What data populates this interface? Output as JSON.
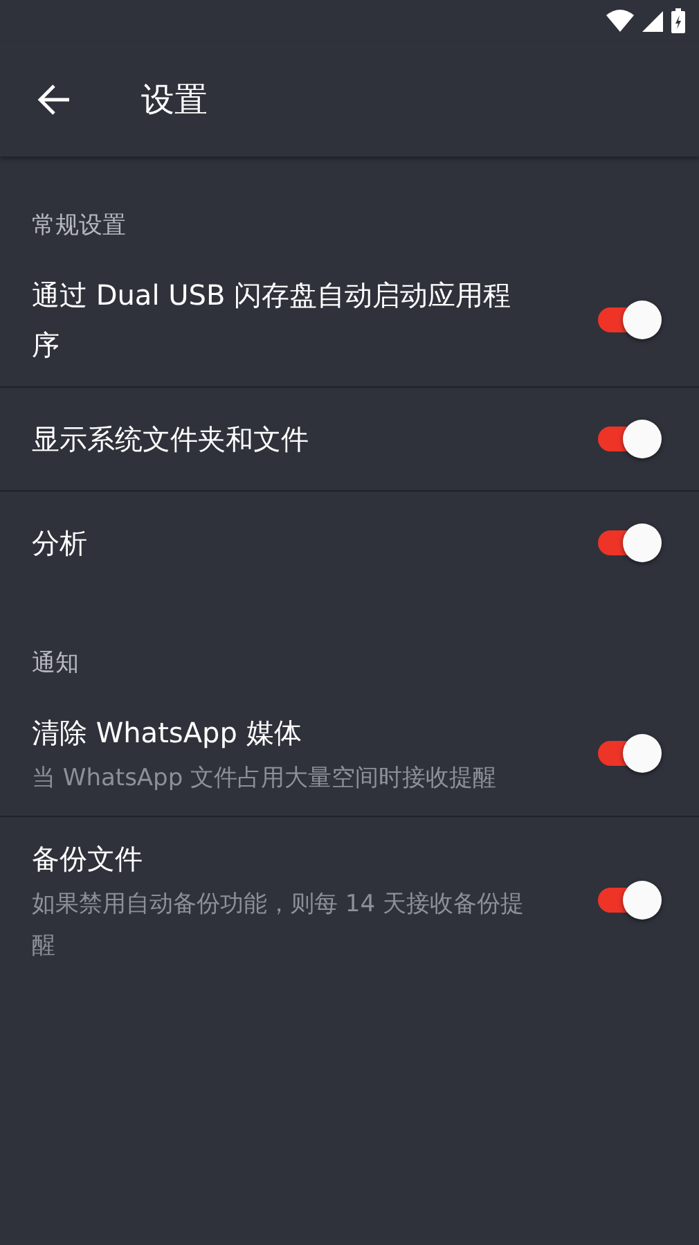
{
  "app_bar": {
    "title": "设置"
  },
  "sections": [
    {
      "header": "常规设置",
      "items": [
        {
          "title": "通过 Dual USB 闪存盘自动启动应用程序",
          "on": true
        },
        {
          "title": "显示系统文件夹和文件",
          "on": true
        },
        {
          "title": "分析",
          "on": true
        }
      ]
    },
    {
      "header": "通知",
      "items": [
        {
          "title": "清除 WhatsApp 媒体",
          "subtitle": "当 WhatsApp 文件占用大量空间时接收提醒",
          "on": true
        },
        {
          "title": "备份文件",
          "subtitle": "如果禁用自动备份功能，则每 14 天接收备份提醒",
          "on": true
        }
      ]
    }
  ]
}
